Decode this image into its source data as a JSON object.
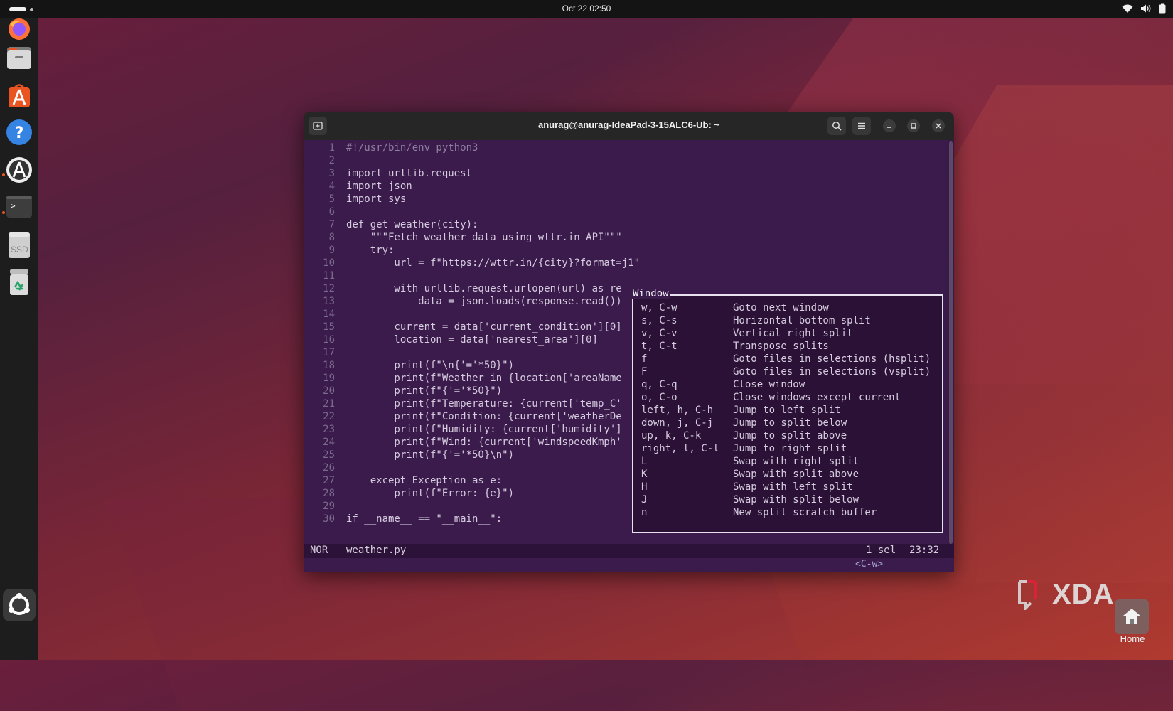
{
  "topbar": {
    "clock": "Oct 22  02:50"
  },
  "dock": {
    "apps": [
      {
        "name": "firefox"
      },
      {
        "name": "files"
      },
      {
        "name": "app-center"
      },
      {
        "name": "help"
      },
      {
        "name": "software-updater"
      },
      {
        "name": "terminal"
      },
      {
        "name": "ssd-drive",
        "label": "SSD"
      },
      {
        "name": "trash"
      },
      {
        "name": "show-apps"
      }
    ]
  },
  "window": {
    "title": "anurag@anurag-IdeaPad-3-15ALC6-Ub: ~",
    "buttons": [
      "new-tab",
      "search",
      "menu",
      "minimize",
      "maximize",
      "close"
    ]
  },
  "editor": {
    "lines": [
      {
        "n": "1",
        "t": "#!/usr/bin/env python3"
      },
      {
        "n": "2",
        "t": ""
      },
      {
        "n": "3",
        "t": "import urllib.request"
      },
      {
        "n": "4",
        "t": "import json"
      },
      {
        "n": "5",
        "t": "import sys"
      },
      {
        "n": "6",
        "t": ""
      },
      {
        "n": "7",
        "t": "def get_weather(city):"
      },
      {
        "n": "8",
        "t": "    \"\"\"Fetch weather data using wttr.in API\"\"\""
      },
      {
        "n": "9",
        "t": "    try:"
      },
      {
        "n": "10",
        "t": "        url = f\"https://wttr.in/{city}?format=j1\""
      },
      {
        "n": "11",
        "t": ""
      },
      {
        "n": "12",
        "t": "        with urllib.request.urlopen(url) as re"
      },
      {
        "n": "13",
        "t": "            data = json.loads(response.read())"
      },
      {
        "n": "14",
        "t": ""
      },
      {
        "n": "15",
        "t": "        current = data['current_condition'][0]"
      },
      {
        "n": "16",
        "t": "        location = data['nearest_area'][0]"
      },
      {
        "n": "17",
        "t": ""
      },
      {
        "n": "18",
        "t": "        print(f\"\\n{'='*50}\")"
      },
      {
        "n": "19",
        "t": "        print(f\"Weather in {location['areaName"
      },
      {
        "n": "20",
        "t": "        print(f\"{'='*50}\")"
      },
      {
        "n": "21",
        "t": "        print(f\"Temperature: {current['temp_C'"
      },
      {
        "n": "22",
        "t": "        print(f\"Condition: {current['weatherDe"
      },
      {
        "n": "23",
        "t": "        print(f\"Humidity: {current['humidity']"
      },
      {
        "n": "24",
        "t": "        print(f\"Wind: {current['windspeedKmph'"
      },
      {
        "n": "25",
        "t": "        print(f\"{'='*50}\\n\")"
      },
      {
        "n": "26",
        "t": ""
      },
      {
        "n": "27",
        "t": "    except Exception as e:"
      },
      {
        "n": "28",
        "t": "        print(f\"Error: {e}\")"
      },
      {
        "n": "29",
        "t": ""
      },
      {
        "n": "30",
        "t": "if __name__ == \"__main__\":"
      }
    ]
  },
  "statusline": {
    "mode": "NOR",
    "filename": "weather.py",
    "selection": "1 sel",
    "position": "23:32"
  },
  "cmdline": {
    "pending_keys": "<C-w>"
  },
  "popup": {
    "title": "Window",
    "items": [
      {
        "key": "w, C-w",
        "desc": "Goto next window"
      },
      {
        "key": "s, C-s",
        "desc": "Horizontal bottom split"
      },
      {
        "key": "v, C-v",
        "desc": "Vertical right split"
      },
      {
        "key": "t, C-t",
        "desc": "Transpose splits"
      },
      {
        "key": "f",
        "desc": "Goto files in selections (hsplit)"
      },
      {
        "key": "F",
        "desc": "Goto files in selections (vsplit)"
      },
      {
        "key": "q, C-q",
        "desc": "Close window"
      },
      {
        "key": "o, C-o",
        "desc": "Close windows except current"
      },
      {
        "key": "left, h, C-h",
        "desc": "Jump to left split"
      },
      {
        "key": "down, j, C-j",
        "desc": "Jump to split below"
      },
      {
        "key": "up, k, C-k",
        "desc": "Jump to split above"
      },
      {
        "key": "right, l, C-l",
        "desc": "Jump to right split"
      },
      {
        "key": "L",
        "desc": "Swap with right split"
      },
      {
        "key": "K",
        "desc": "Swap with split above"
      },
      {
        "key": "H",
        "desc": "Swap with left split"
      },
      {
        "key": "J",
        "desc": "Swap with split below"
      },
      {
        "key": "n",
        "desc": "New split scratch buffer"
      }
    ]
  },
  "watermark": {
    "brand": "XDA"
  },
  "desktop": {
    "home_label": "Home"
  },
  "colors": {
    "accent": "#e95420",
    "terminal_bg": "#3b1b4b",
    "popup_bg": "#2b1136"
  }
}
